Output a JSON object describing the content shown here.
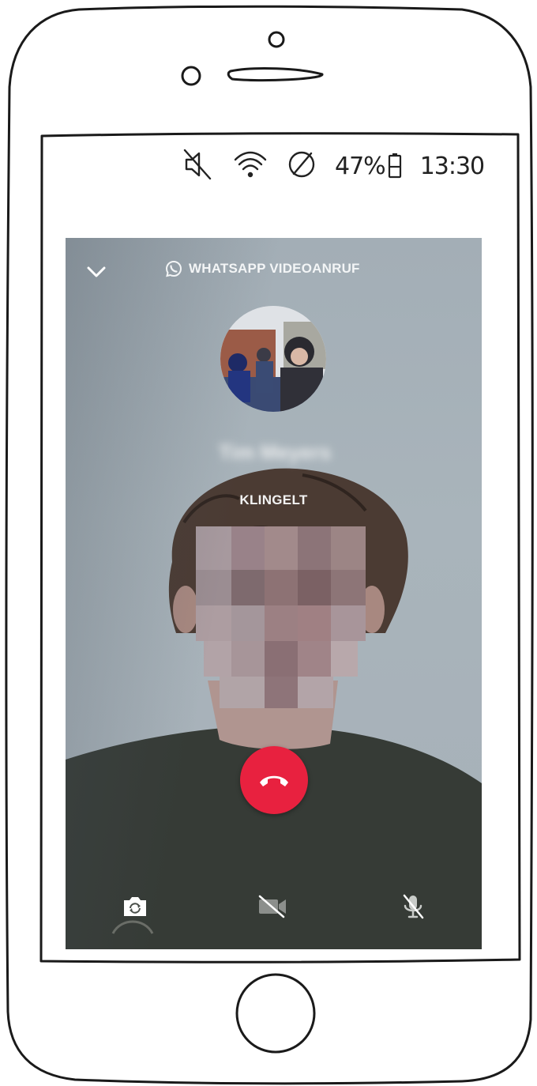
{
  "status_bar": {
    "icons": [
      "mute-icon",
      "wifi-icon",
      "no-disturb-icon",
      "battery-icon"
    ],
    "battery": "47%",
    "time": "13:30"
  },
  "call": {
    "header_label": "WHATSAPP VIDEOANRUF",
    "contact_name": "Tim Meyers",
    "status": "KLINGELT"
  },
  "controls": {
    "icons": [
      "switch-camera-icon",
      "video-off-icon",
      "mic-off-icon",
      "end-call-icon"
    ]
  },
  "colors": {
    "end_call": "#e8213f",
    "screen_bg": "#a6b0b8"
  }
}
